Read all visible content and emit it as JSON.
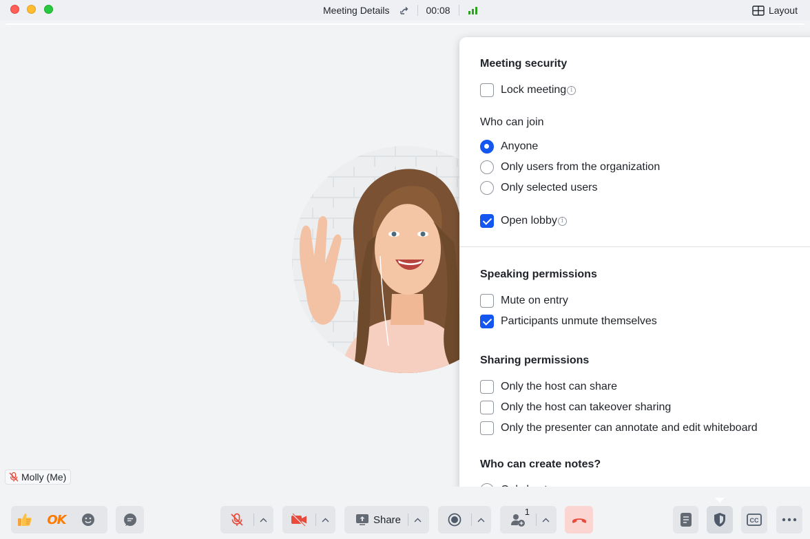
{
  "titlebar": {
    "meeting_details": "Meeting Details",
    "timer": "00:08",
    "layout_label": "Layout"
  },
  "participant": {
    "name": "Molly (Me)"
  },
  "security_panel": {
    "meeting_security": {
      "heading": "Meeting security",
      "lock_meeting": "Lock meeting",
      "lock_checked": false
    },
    "who_can_join": {
      "heading": "Who can join",
      "options": [
        "Anyone",
        "Only users from the organization",
        "Only selected users"
      ],
      "selected": "Anyone",
      "open_lobby": "Open lobby",
      "open_lobby_checked": true
    },
    "speaking_permissions": {
      "heading": "Speaking permissions",
      "mute_on_entry": "Mute on entry",
      "mute_on_entry_checked": false,
      "unmute_themselves": "Participants unmute themselves",
      "unmute_themselves_checked": true
    },
    "sharing_permissions": {
      "heading": "Sharing permissions",
      "host_share": "Only the host can share",
      "host_takeover": "Only the host can takeover sharing",
      "presenter_annotate": "Only the presenter can annotate and edit whiteboard"
    },
    "create_notes": {
      "heading": "Who can create notes?",
      "only_host": "Only host"
    }
  },
  "toolbar": {
    "ok_reaction": "OK",
    "share_label": "Share",
    "participants_count": "1"
  },
  "colors": {
    "accent": "#1456f0",
    "end_call_bg": "#fbd5d2",
    "end_call_icon": "#e84b3c",
    "muted_red": "#e84b3c"
  }
}
